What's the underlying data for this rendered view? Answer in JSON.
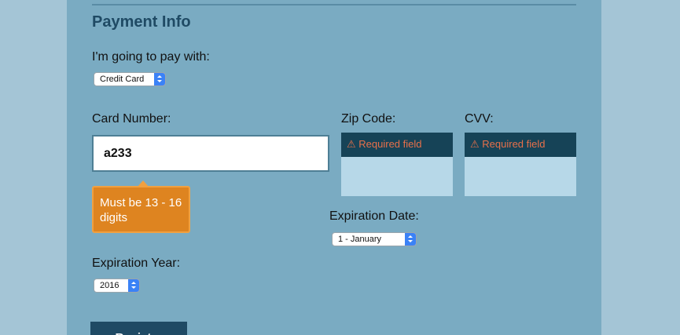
{
  "section": {
    "heading": "Payment Info"
  },
  "pay_with": {
    "label": "I'm going to pay with:",
    "selected": "Credit Card"
  },
  "card_number": {
    "label": "Card Number:",
    "value": "a233",
    "tooltip": "Must be 13 - 16 digits"
  },
  "zip_code": {
    "label": "Zip Code:",
    "error": "Required field"
  },
  "cvv": {
    "label": "CVV:",
    "error": "Required field"
  },
  "expiration_date": {
    "label": "Expiration Date:",
    "selected": "1 - January"
  },
  "expiration_year": {
    "label": "Expiration Year:",
    "selected": "2016"
  },
  "register_button": {
    "label": "Register"
  },
  "icons": {
    "warning": "⚠"
  },
  "colors": {
    "error_text": "#e8704a",
    "tooltip_bg": "#de8420",
    "heading": "#1f4a64"
  }
}
